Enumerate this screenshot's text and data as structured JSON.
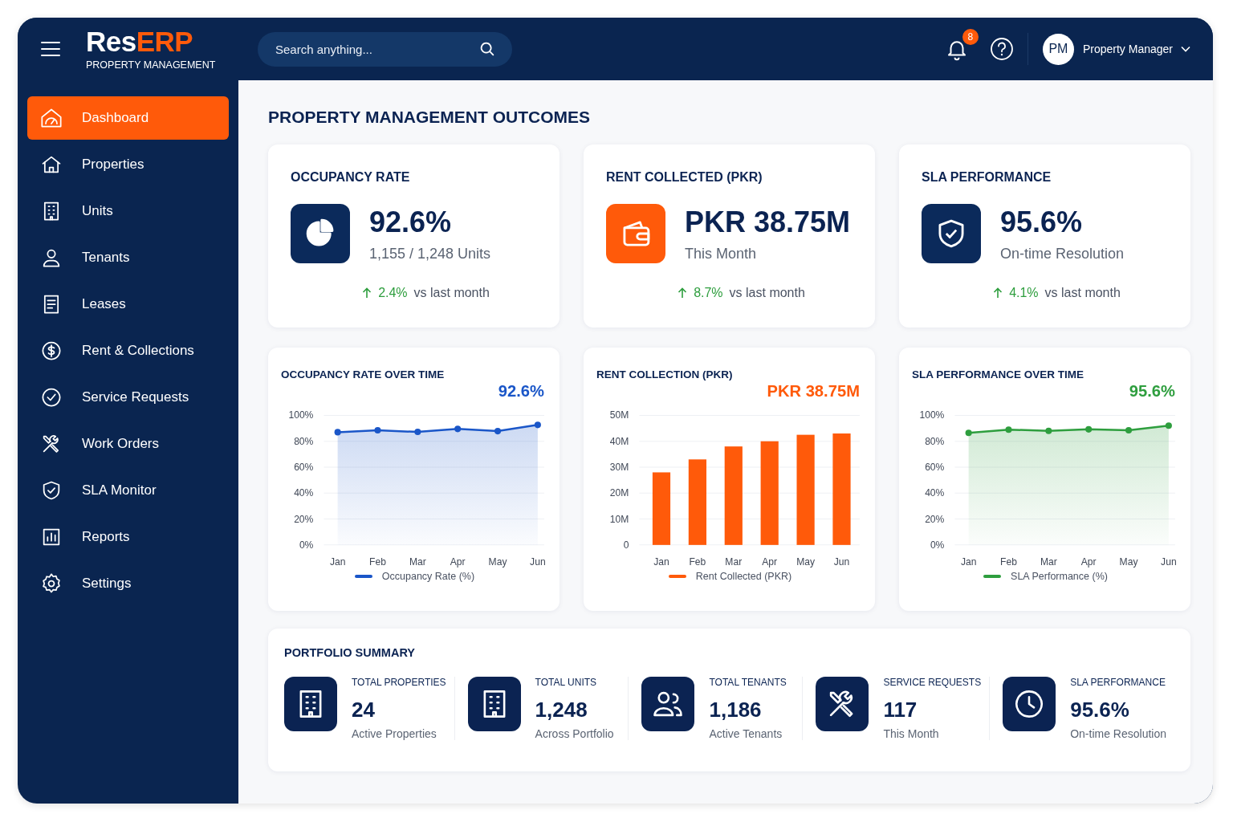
{
  "brand": {
    "name_main": "Res",
    "name_accent": "ERP",
    "tagline": "PROPERTY MANAGEMENT"
  },
  "search": {
    "placeholder": "Search anything..."
  },
  "notifications": {
    "count": "8"
  },
  "user": {
    "initials": "PM",
    "name": "Property Manager"
  },
  "sidebar": {
    "items": [
      {
        "label": "Dashboard",
        "selected": true
      },
      {
        "label": "Properties",
        "selected": false
      },
      {
        "label": "Units",
        "selected": false
      },
      {
        "label": "Tenants",
        "selected": false
      },
      {
        "label": "Leases",
        "selected": false
      },
      {
        "label": "Rent & Collections",
        "selected": false
      },
      {
        "label": "Service Requests",
        "selected": false
      },
      {
        "label": "Work Orders",
        "selected": false
      },
      {
        "label": "SLA Monitor",
        "selected": false
      },
      {
        "label": "Reports",
        "selected": false
      },
      {
        "label": "Settings",
        "selected": false
      }
    ]
  },
  "page_title": "PROPERTY MANAGEMENT OUTCOMES",
  "kpis": [
    {
      "title": "OCCUPANCY RATE",
      "value": "92.6%",
      "detail": "1,155 / 1,248 Units",
      "change": "2.4%",
      "change_note": "vs last month",
      "color": "#0b2a5b"
    },
    {
      "title": "RENT COLLECTED (PKR)",
      "value": "PKR 38.75M",
      "detail": "This Month",
      "change": "8.7%",
      "change_note": "vs last month",
      "color": "#ff5a0a"
    },
    {
      "title": "SLA PERFORMANCE",
      "value": "95.6%",
      "detail": "On-time Resolution",
      "change": "4.1%",
      "change_note": "vs last month",
      "color": "#0b2a5b"
    }
  ],
  "charts": [
    {
      "title": "OCCUPANCY RATE OVER TIME",
      "headline": "92.6%",
      "chart_data": {
        "type": "line",
        "grid": true,
        "categories": [
          "Jan",
          "Feb",
          "Mar",
          "Apr",
          "May",
          "Jun"
        ],
        "ylim": [
          0,
          100
        ],
        "yticks": [
          {
            "value": 0,
            "label": "0%"
          },
          {
            "value": 20,
            "label": "20%"
          },
          {
            "value": 40,
            "label": "40%"
          },
          {
            "value": 60,
            "label": "60%"
          },
          {
            "value": 80,
            "label": "80%"
          },
          {
            "value": 100,
            "label": "100%"
          }
        ],
        "series": [
          {
            "name": "Occupancy Rate (%)",
            "color": "#1a56c8",
            "marker": "circle",
            "values": [
              87,
              88.5,
              87.2,
              89.5,
              87.8,
              92.6
            ]
          }
        ]
      }
    },
    {
      "title": "RENT COLLECTION (PKR)",
      "headline": "PKR 38.75M",
      "chart_data": {
        "type": "bar",
        "grid": true,
        "categories": [
          "Jan",
          "Feb",
          "Mar",
          "Apr",
          "May",
          "Jun"
        ],
        "ylim": [
          0,
          50
        ],
        "yticks": [
          {
            "value": 0,
            "label": "0"
          },
          {
            "value": 10,
            "label": "10M"
          },
          {
            "value": 20,
            "label": "20M"
          },
          {
            "value": 30,
            "label": "30M"
          },
          {
            "value": 40,
            "label": "40M"
          },
          {
            "value": 50,
            "label": "50M"
          }
        ],
        "series": [
          {
            "name": "Rent Collected (PKR)",
            "color": "#ff5a0a",
            "values": [
              28,
              33,
              38,
              40,
              42.5,
              43
            ]
          }
        ]
      }
    },
    {
      "title": "SLA PERFORMANCE OVER TIME",
      "headline": "95.6%",
      "chart_data": {
        "type": "line",
        "grid": true,
        "categories": [
          "Jan",
          "Feb",
          "Mar",
          "Apr",
          "May",
          "Jun"
        ],
        "ylim": [
          0,
          100
        ],
        "yticks": [
          {
            "value": 0,
            "label": "0%"
          },
          {
            "value": 20,
            "label": "20%"
          },
          {
            "value": 40,
            "label": "40%"
          },
          {
            "value": 60,
            "label": "60%"
          },
          {
            "value": 80,
            "label": "80%"
          },
          {
            "value": 100,
            "label": "100%"
          }
        ],
        "series": [
          {
            "name": "SLA Performance (%)",
            "color": "#2e9e3e",
            "marker": "circle",
            "values": [
              86.5,
              89,
              88,
              89.2,
              88.5,
              92
            ]
          }
        ]
      }
    }
  ],
  "summary": {
    "title": "PORTFOLIO SUMMARY",
    "items": [
      {
        "label": "TOTAL PROPERTIES",
        "value": "24",
        "note": "Active Properties"
      },
      {
        "label": "TOTAL UNITS",
        "value": "1,248",
        "note": "Across Portfolio"
      },
      {
        "label": "TOTAL TENANTS",
        "value": "1,186",
        "note": "Active Tenants"
      },
      {
        "label": "SERVICE REQUESTS",
        "value": "117",
        "note": "This Month"
      },
      {
        "label": "SLA PERFORMANCE",
        "value": "95.6%",
        "note": "On-time Resolution"
      }
    ]
  }
}
